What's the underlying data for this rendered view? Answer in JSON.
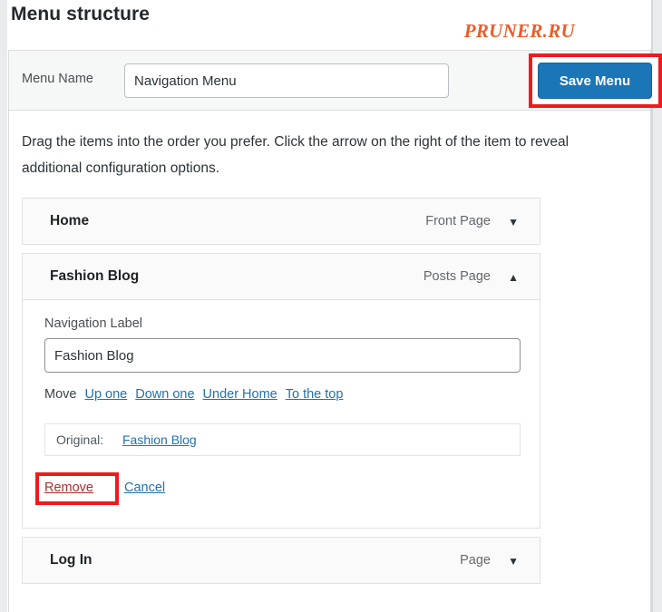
{
  "page_title": "Menu structure",
  "watermark": "PRUNER.RU",
  "menu_name": {
    "label": "Menu Name",
    "value": "Navigation Menu",
    "save_button": "Save Menu"
  },
  "instructions": "Drag the items into the order you prefer. Click the arrow on the right of the item to reveal additional configuration options.",
  "menu_items": [
    {
      "title": "Home",
      "type": "Front Page",
      "arrow": "▼",
      "expanded": false
    },
    {
      "title": "Fashion Blog",
      "type": "Posts Page",
      "arrow": "▲",
      "expanded": true,
      "panel": {
        "nav_label_caption": "Navigation Label",
        "nav_label_value": "Fashion Blog",
        "move_caption": "Move",
        "move_links": [
          "Up one",
          "Down one",
          "Under Home",
          "To the top"
        ],
        "original_caption": "Original:",
        "original_link": "Fashion Blog",
        "remove_link": "Remove",
        "cancel_link": "Cancel"
      }
    },
    {
      "title": "Log In",
      "type": "Page",
      "arrow": "▼",
      "expanded": false
    }
  ],
  "colors": {
    "accent_blue": "#1b76b8",
    "link_blue": "#2271b1",
    "danger_red": "#b32d2e",
    "annotation_red": "#f01a1a",
    "watermark_orange": "#ef5b25"
  }
}
